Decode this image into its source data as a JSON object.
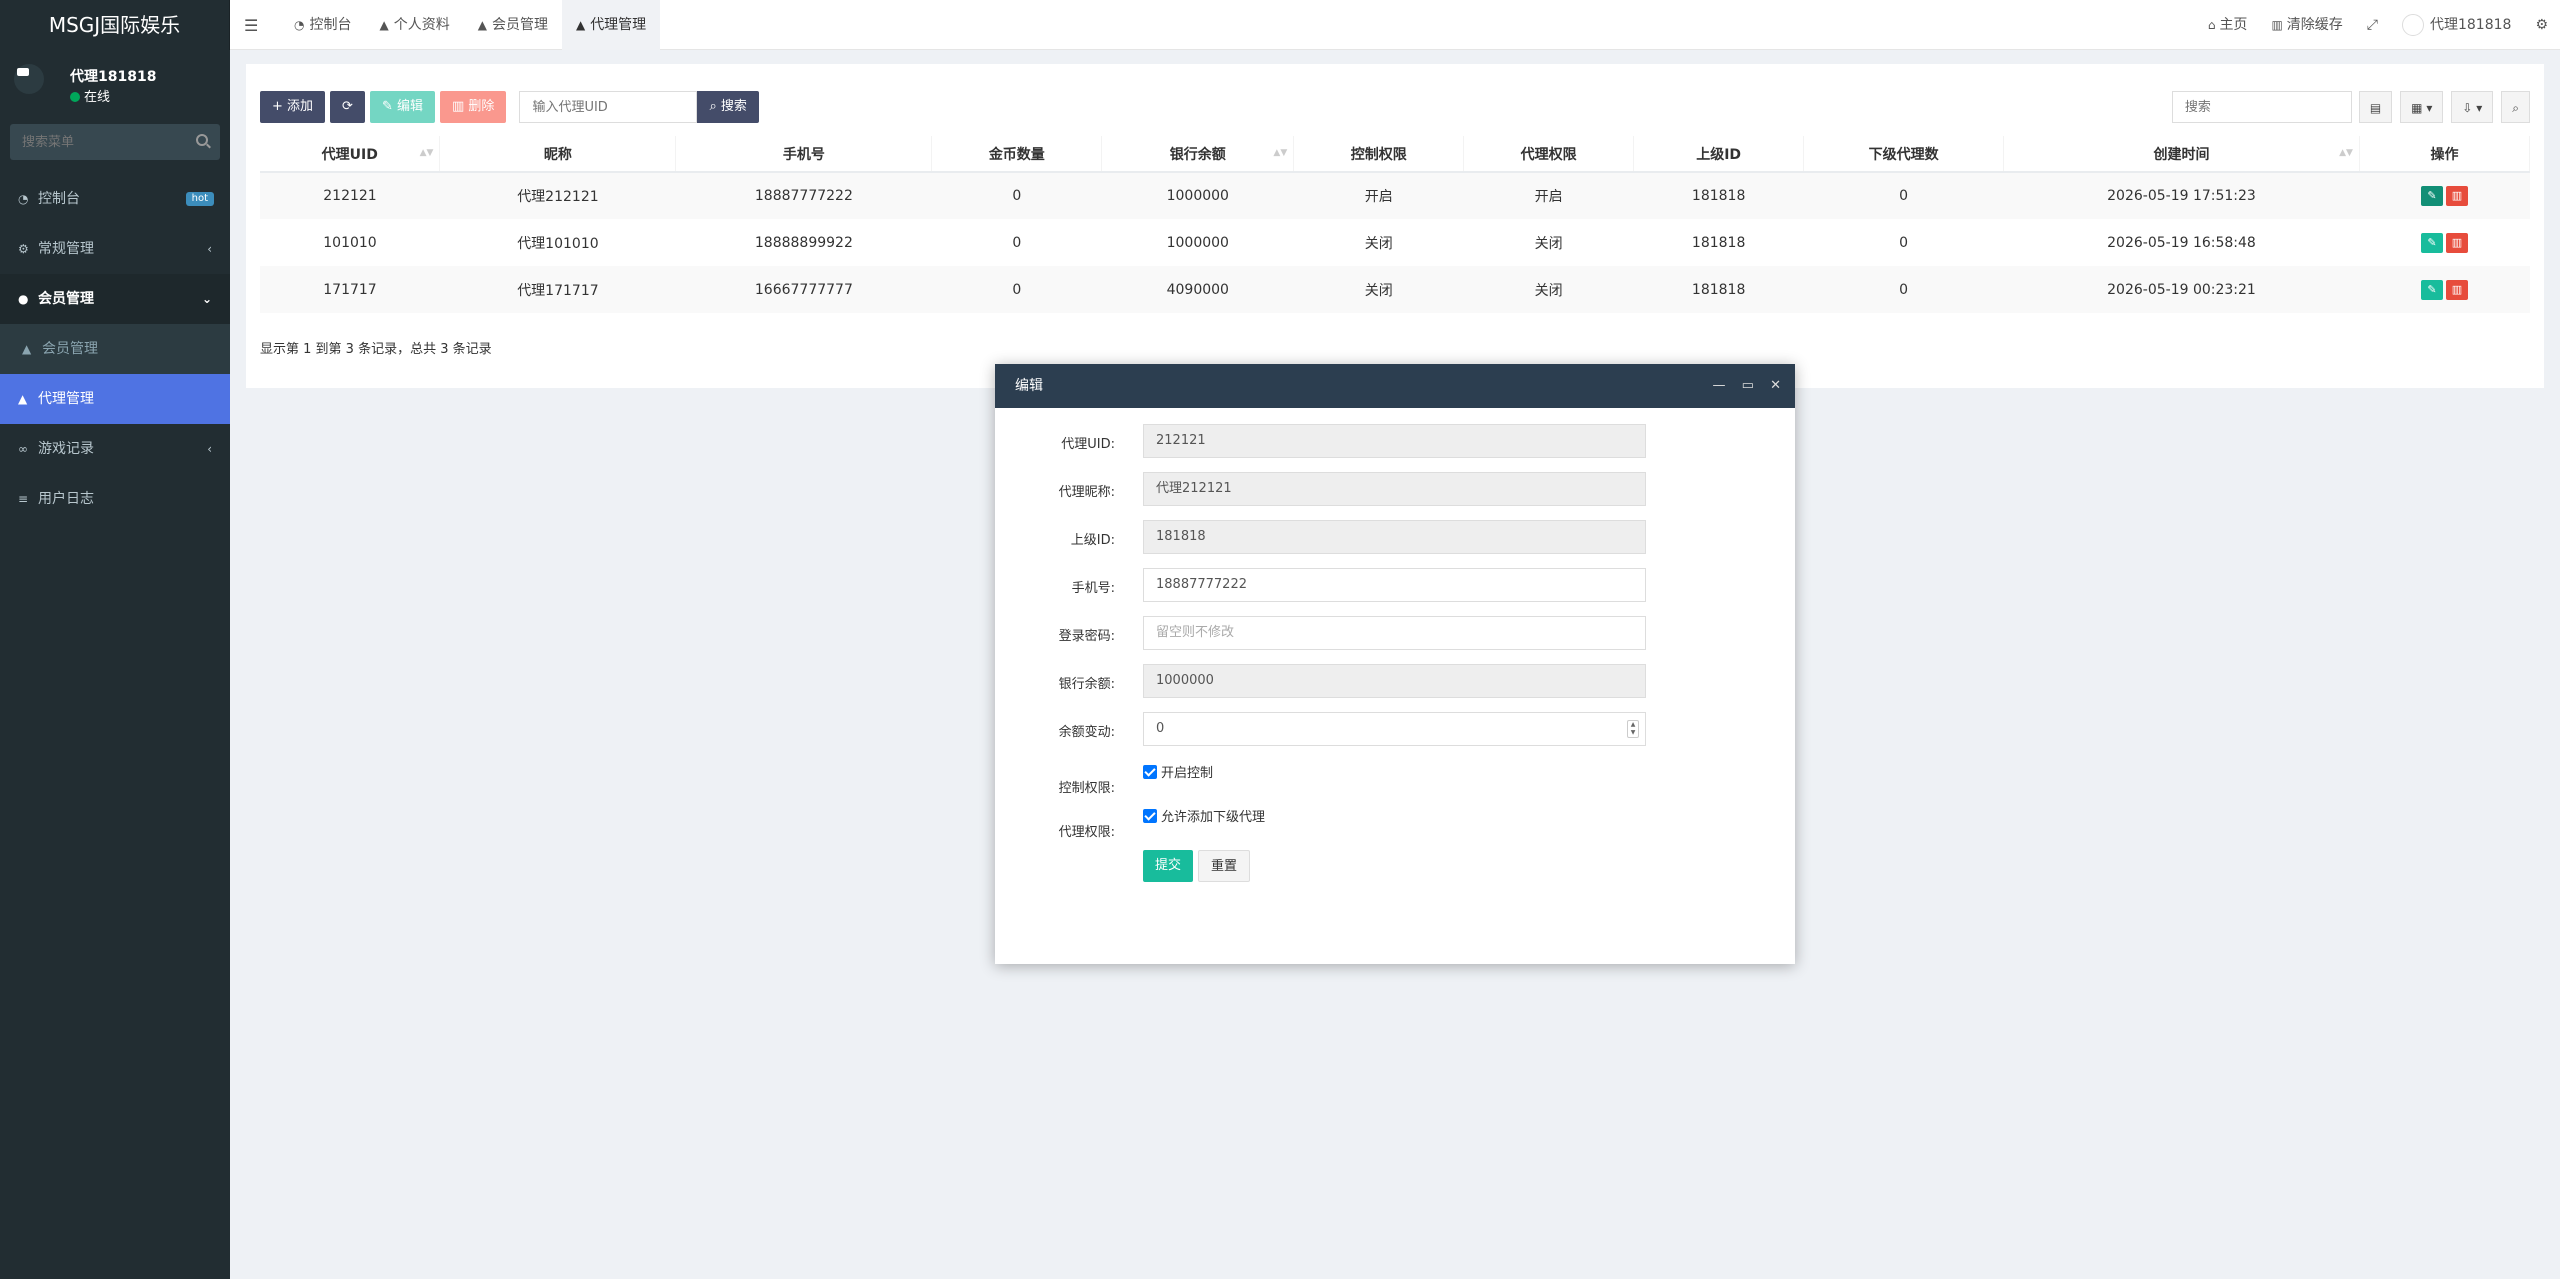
{
  "brand": "MSGJ国际娱乐",
  "user": {
    "name": "代理181818",
    "status": "在线"
  },
  "sidebar": {
    "search_placeholder": "搜索菜单",
    "items": [
      {
        "label": "控制台",
        "icon": "dashboard-icon",
        "badge": "hot"
      },
      {
        "label": "常规管理",
        "icon": "cogs-icon"
      },
      {
        "label": "会员管理",
        "icon": "user-circle-icon"
      },
      {
        "label": "会员管理",
        "icon": "user-icon"
      },
      {
        "label": "代理管理",
        "icon": "users-icon"
      },
      {
        "label": "游戏记录",
        "icon": "gamepad-icon"
      },
      {
        "label": "用户日志",
        "icon": "database-icon"
      }
    ]
  },
  "header": {
    "tabs": [
      {
        "label": "控制台",
        "icon": "dashboard-icon"
      },
      {
        "label": "个人资料",
        "icon": "user-icon"
      },
      {
        "label": "会员管理",
        "icon": "user-icon"
      },
      {
        "label": "代理管理",
        "icon": "users-icon"
      }
    ],
    "home": "主页",
    "clear_cache": "清除缓存",
    "username": "代理181818"
  },
  "toolbar": {
    "add": "添加",
    "edit": "编辑",
    "delete": "删除",
    "search_placeholder": "输入代理UID",
    "search": "搜索",
    "right_search_placeholder": "搜索"
  },
  "table": {
    "columns": [
      "代理UID",
      "昵称",
      "手机号",
      "金币数量",
      "银行余额",
      "控制权限",
      "代理权限",
      "上级ID",
      "下级代理数",
      "创建时间",
      "操作"
    ],
    "rows": [
      [
        "212121",
        "代理212121",
        "18887777222",
        "0",
        "1000000",
        "开启",
        "开启",
        "181818",
        "0",
        "2026-05-19 17:51:23"
      ],
      [
        "101010",
        "代理101010",
        "18888899922",
        "0",
        "1000000",
        "关闭",
        "关闭",
        "181818",
        "0",
        "2026-05-19 16:58:48"
      ],
      [
        "171717",
        "代理171717",
        "16667777777",
        "0",
        "4090000",
        "关闭",
        "关闭",
        "181818",
        "0",
        "2026-05-19 00:23:21"
      ]
    ],
    "summary": "显示第 1 到第 3 条记录，总共 3 条记录"
  },
  "modal": {
    "title": "编辑",
    "fields": {
      "uid_label": "代理UID:",
      "uid": "212121",
      "nick_label": "代理昵称:",
      "nick": "代理212121",
      "parent_label": "上级ID:",
      "parent": "181818",
      "phone_label": "手机号:",
      "phone": "18887777222",
      "pwd_label": "登录密码:",
      "pwd_placeholder": "留空则不修改",
      "bank_label": "银行余额:",
      "bank": "1000000",
      "change_label": "余额变动:",
      "change": "0",
      "control_label": "控制权限:",
      "control_check": "开启控制",
      "agent_label": "代理权限:",
      "agent_check": "允许添加下级代理"
    },
    "submit": "提交",
    "reset": "重置"
  }
}
